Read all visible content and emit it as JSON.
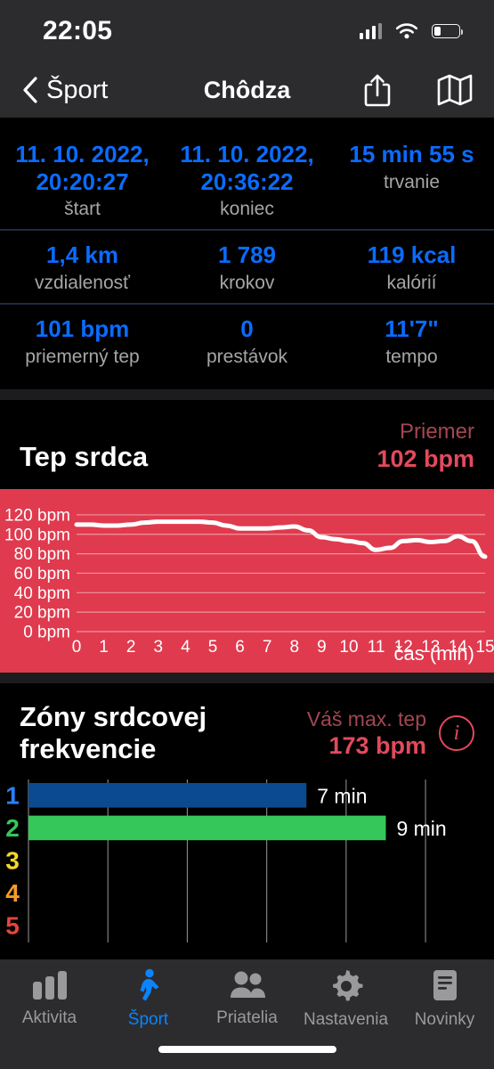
{
  "status_bar": {
    "time": "22:05",
    "signal_icon": "cellular-bars-icon",
    "wifi_icon": "wifi-icon",
    "battery_icon": "battery-icon",
    "battery_level_pct": 27
  },
  "nav": {
    "back_label": "Šport",
    "back_icon": "chevron-left-icon",
    "title": "Chôdza",
    "share_icon": "share-icon",
    "map_icon": "map-icon"
  },
  "stats": {
    "rows": [
      [
        {
          "value": "11. 10. 2022, 20:20:27",
          "label": "štart"
        },
        {
          "value": "11. 10. 2022, 20:36:22",
          "label": "koniec"
        },
        {
          "value": "15 min 55 s",
          "label": "trvanie"
        }
      ],
      [
        {
          "value": "1,4 km",
          "label": "vzdialenosť"
        },
        {
          "value": "1 789",
          "label": "krokov"
        },
        {
          "value": "119 kcal",
          "label": "kalórií"
        }
      ],
      [
        {
          "value": "101 bpm",
          "label": "priemerný tep"
        },
        {
          "value": "0",
          "label": "prestávok"
        },
        {
          "value": "11'7\"",
          "label": "tempo"
        }
      ]
    ],
    "value_color": "#0a6cff",
    "label_color": "#a6a6a8"
  },
  "heart_rate": {
    "title": "Tep srdca",
    "average_label": "Priemer",
    "average_value": "102 bpm",
    "accent_color": "#e24a5c",
    "chart_bg": "#e03a4e"
  },
  "zones": {
    "title": "Zóny srdcovej frekvencie",
    "max_label": "Váš max. tep",
    "max_value": "173 bpm",
    "info_icon": "info-circle-icon",
    "info_glyph": "i"
  },
  "tabbar": {
    "items": [
      {
        "label": "Aktivita",
        "icon": "bar-chart-icon",
        "active": false
      },
      {
        "label": "Šport",
        "icon": "walking-person-icon",
        "active": true
      },
      {
        "label": "Priatelia",
        "icon": "people-icon",
        "active": false
      },
      {
        "label": "Nastavenia",
        "icon": "gear-icon",
        "active": false
      },
      {
        "label": "Novinky",
        "icon": "news-document-icon",
        "active": false
      }
    ],
    "active_color": "#0a84ff",
    "inactive_color": "#9a9a9c"
  },
  "chart_data": [
    {
      "type": "line",
      "title": "Tep srdca",
      "xlabel": "čas (min)",
      "ylabel": "",
      "xlim": [
        0,
        15
      ],
      "ylim": [
        0,
        130
      ],
      "grid": true,
      "legend": "none",
      "background": "#e03a4e",
      "line_color": "#ffffff",
      "y_tick_labels": [
        "0 bpm",
        "20 bpm",
        "40 bpm",
        "60 bpm",
        "80 bpm",
        "100 bpm",
        "120 bpm"
      ],
      "y_ticks": [
        0,
        20,
        40,
        60,
        80,
        100,
        120
      ],
      "x_tick_labels": [
        "0",
        "1",
        "2",
        "3",
        "4",
        "5",
        "6",
        "7",
        "8",
        "9",
        "10",
        "11",
        "12",
        "13",
        "14",
        "15"
      ],
      "x": [
        0,
        0.5,
        1,
        1.5,
        2,
        2.5,
        3,
        3.5,
        4,
        4.5,
        5,
        5.5,
        6,
        6.5,
        7,
        7.5,
        8,
        8.5,
        9,
        9.5,
        10,
        10.5,
        11,
        11.5,
        12,
        12.5,
        13,
        13.5,
        14,
        14.5,
        15
      ],
      "values": [
        110,
        110,
        109,
        109,
        110,
        112,
        113,
        113,
        113,
        113,
        112,
        109,
        106,
        106,
        106,
        107,
        108,
        104,
        97,
        95,
        93,
        91,
        84,
        86,
        93,
        94,
        92,
        93,
        98,
        93,
        77
      ],
      "annotations": []
    },
    {
      "type": "bar",
      "orientation": "horizontal",
      "title": "Zóny srdcovej frekvencie",
      "xlabel": "",
      "ylabel": "",
      "grid": true,
      "categories": [
        "1",
        "2",
        "3",
        "4",
        "5"
      ],
      "values": [
        7,
        9,
        0,
        0,
        0
      ],
      "value_labels": [
        "7 min",
        "9 min",
        "",
        "",
        ""
      ],
      "bar_colors": [
        "#0b4a8f",
        "#35c759",
        "#000000",
        "#000000",
        "#000000"
      ],
      "category_colors": [
        "#2a7fff",
        "#35c759",
        "#f5d72e",
        "#f59b28",
        "#e4453f"
      ],
      "xlim": [
        0,
        11.5
      ],
      "units": "min"
    }
  ]
}
